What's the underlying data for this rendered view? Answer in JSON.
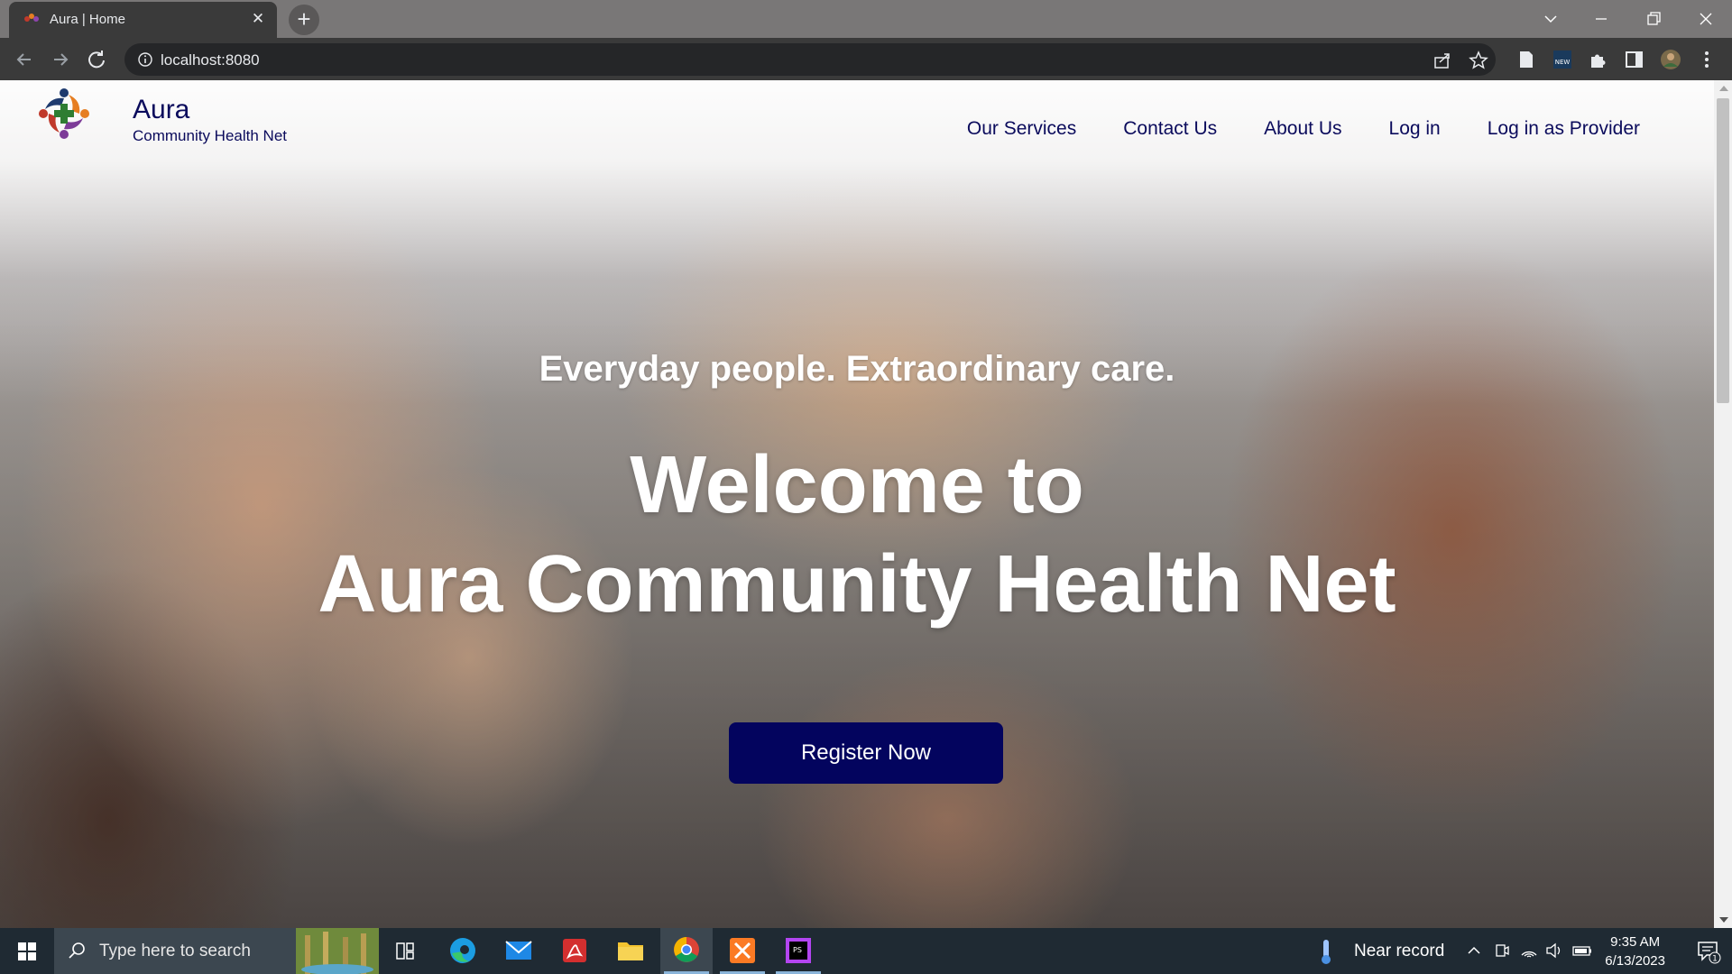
{
  "browser": {
    "tab_title": "Aura | Home",
    "tab_close": "✕",
    "new_tab": "+",
    "url": "localhost:8080",
    "icons": [
      "back-icon",
      "forward-icon",
      "reload-icon",
      "info-icon",
      "share-icon",
      "bookmark-star-icon",
      "reading-list-icon",
      "new-extension-icon",
      "extensions-puzzle-icon",
      "side-panel-icon",
      "profile-avatar",
      "menu-kebab-icon"
    ]
  },
  "site": {
    "brand_name": "Aura",
    "brand_sub": "Community Health Net",
    "nav": [
      "Our Services",
      "Contact Us",
      "About Us",
      "Log in",
      "Log in as Provider"
    ],
    "tagline": "Everyday people. Extraordinary care.",
    "headline_line1": "Welcome to",
    "headline_line2": "Aura Community Health Net",
    "cta": "Register Now",
    "colors": {
      "brand_navy": "#0b0b5c",
      "cta_bg": "#03045e"
    }
  },
  "taskbar": {
    "search_placeholder": "Type here to search",
    "weather": "Near record",
    "time": "9:35 AM",
    "date": "6/13/2023",
    "notification_count": "1",
    "apps": [
      "task-view-icon",
      "edge-icon",
      "mail-icon",
      "acrobat-icon",
      "file-explorer-icon",
      "chrome-icon",
      "xampp-icon",
      "phpstorm-icon"
    ]
  }
}
